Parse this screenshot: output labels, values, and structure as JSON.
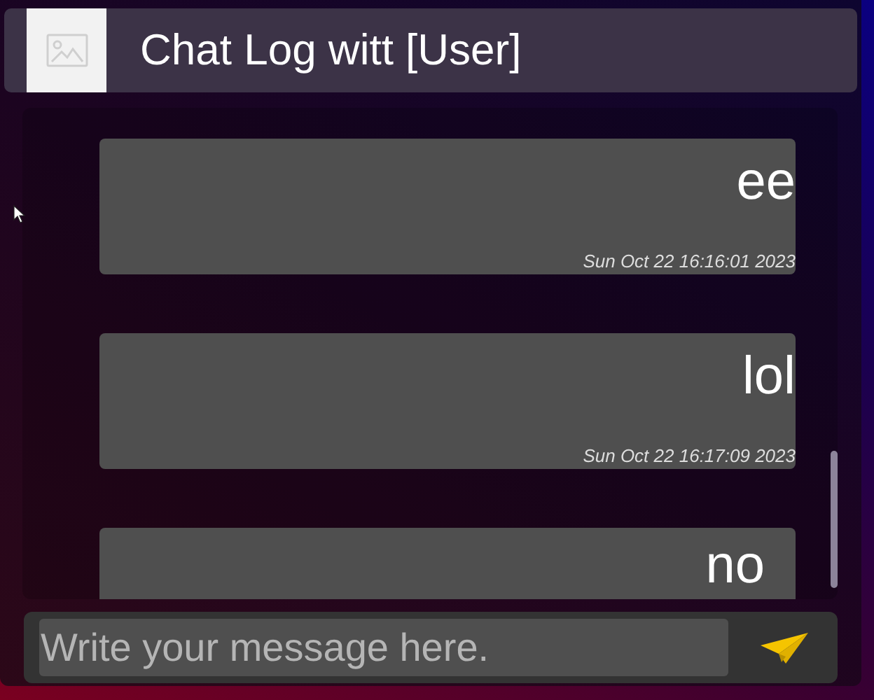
{
  "header": {
    "title": "Chat Log witt [User]"
  },
  "messages": [
    {
      "text": "ee",
      "time": "Sun Oct 22 16:16:01 2023"
    },
    {
      "text": "lol",
      "time": "Sun Oct 22 16:17:09 2023"
    },
    {
      "text": "no"
    }
  ],
  "composer": {
    "placeholder": "Write your message here."
  }
}
